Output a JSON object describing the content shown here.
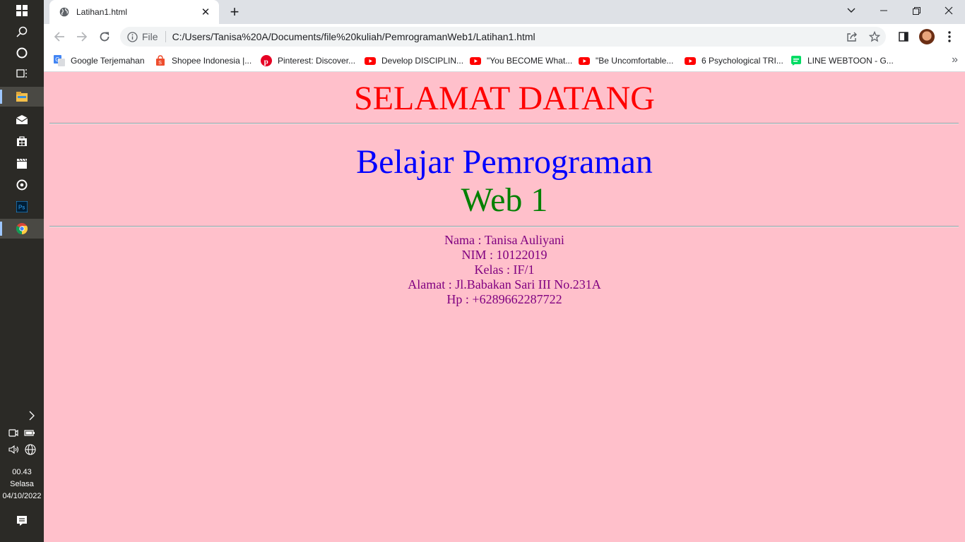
{
  "taskbar": {
    "icons": [
      "windows-start-icon",
      "search-icon",
      "cortana-icon",
      "task-view-icon",
      "file-explorer-icon",
      "mail-icon",
      "store-icon",
      "video-editor-icon",
      "groove-icon",
      "photoshop-icon",
      "chrome-icon"
    ],
    "time": "00.43",
    "day": "Selasa",
    "date": "04/10/2022"
  },
  "browser": {
    "tab": {
      "title": "Latihan1.html",
      "close": "✕"
    },
    "new_tab": "+",
    "address": {
      "scheme_label": "File",
      "url": "C:/Users/Tanisa%20A/Documents/file%20kuliah/PemrogramanWeb1/Latihan1.html"
    },
    "bookmarks": [
      {
        "label": "Google Terjemahan",
        "icon": "google-translate-icon",
        "color": "#4285f4"
      },
      {
        "label": "Shopee Indonesia |...",
        "icon": "shopee-icon",
        "color": "#ee4d2d"
      },
      {
        "label": "Pinterest: Discover...",
        "icon": "pinterest-icon",
        "color": "#e60023"
      },
      {
        "label": "Develop DISCIPLIN...",
        "icon": "youtube-icon",
        "color": "#ff0000"
      },
      {
        "label": "\"You BECOME What...",
        "icon": "youtube-icon",
        "color": "#ff0000"
      },
      {
        "label": "\"Be Uncomfortable...",
        "icon": "youtube-icon",
        "color": "#ff0000"
      },
      {
        "label": "6 Psychological TRI...",
        "icon": "youtube-icon",
        "color": "#ff0000"
      },
      {
        "label": "LINE WEBTOON - G...",
        "icon": "webtoon-icon",
        "color": "#00dc64"
      }
    ],
    "more": "»"
  },
  "page": {
    "background": "#ffc0cb",
    "welcome": "SELAMAT DATANG",
    "heading_line1": "Belajar Pemrograman",
    "heading_line2": "Web 1",
    "info": [
      "Nama : Tanisa Auliyani",
      "NIM : 10122019",
      "Kelas : IF/1",
      "Alamat : Jl.Babakan Sari III No.231A",
      "Hp : +6289662287722"
    ]
  }
}
